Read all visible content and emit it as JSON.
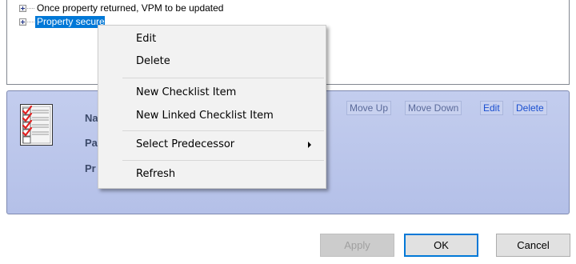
{
  "tree": {
    "items": [
      {
        "label": "Once property returned, VPM to be updated",
        "selected": false
      },
      {
        "label": "Property secured",
        "selected": true
      }
    ]
  },
  "details": {
    "field_labels": [
      "Na",
      "Pa",
      "Pr"
    ],
    "actions": {
      "move_up": "Move Up",
      "move_down": "Move Down",
      "edit": "Edit",
      "delete": "Delete"
    }
  },
  "buttons": {
    "apply": "Apply",
    "ok": "OK",
    "cancel": "Cancel"
  },
  "context_menu": {
    "edit": "Edit",
    "delete": "Delete",
    "new_checklist_item": "New Checklist Item",
    "new_linked_checklist_item": "New Linked Checklist Item",
    "select_predecessor": "Select Predecessor",
    "refresh": "Refresh"
  },
  "colors": {
    "selection": "#0078d7",
    "panel": "#b9c4ea",
    "link": "#1a4fd0"
  }
}
